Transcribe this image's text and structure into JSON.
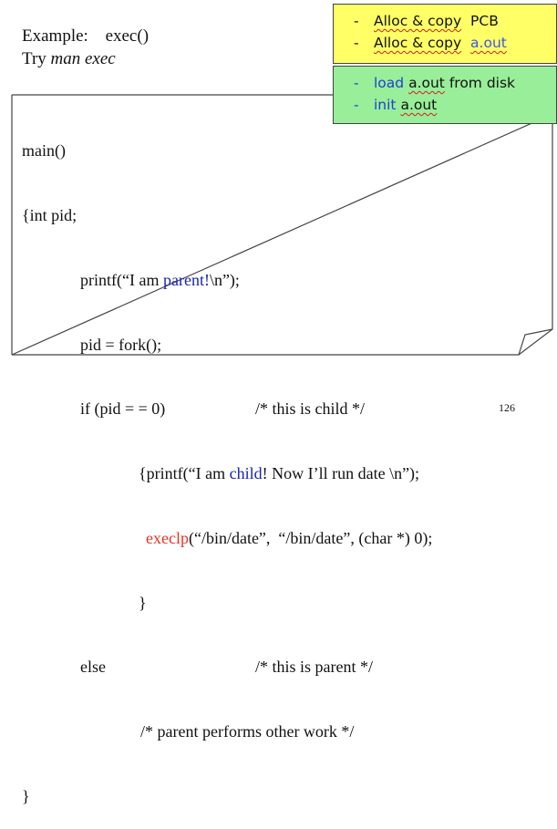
{
  "header": {
    "example_label": "Example:",
    "example_value": "exec()",
    "try_text": "Try ",
    "try_italic": "man exec"
  },
  "note_yellow": {
    "line1_dash": "-",
    "line1_text": "Alloc & copy",
    "line1_word": "PCB",
    "line2_dash": "-",
    "line2_text": "Alloc & copy",
    "line2_word": "a.out"
  },
  "note_green": {
    "line1_dash": "-",
    "line1_kw": "load",
    "line1_word": "a.out",
    "line1_rest": "from disk",
    "line2_dash": "-",
    "line2_kw": "init",
    "line2_word": "a.out"
  },
  "code": {
    "l1": "main()",
    "l2": "{int pid;",
    "l3_a": "printf(“I am ",
    "l3_b": "parent!",
    "l3_c": "\\n”);",
    "l4": "pid = fork();",
    "l5_a": "if (pid = = 0)",
    "l5_b": "/* this is child */",
    "l6_a": "{printf(“I am ",
    "l6_b": "child",
    "l6_c": "! Now I’ll run date \\n”);",
    "l7_a": "execlp",
    "l7_b": "(“/bin/date”,  “/bin/date”, (char *) 0);",
    "l8": "}",
    "l9_a": "else",
    "l9_b": "/* this is parent */",
    "l10": "/* parent performs other work */",
    "l11": "}"
  },
  "page_number": "126",
  "colors": {
    "note_yellow_bg": "#ffff66",
    "note_green_bg": "#99ee99",
    "code_blue": "#1a23b4",
    "code_red": "#e53224"
  }
}
